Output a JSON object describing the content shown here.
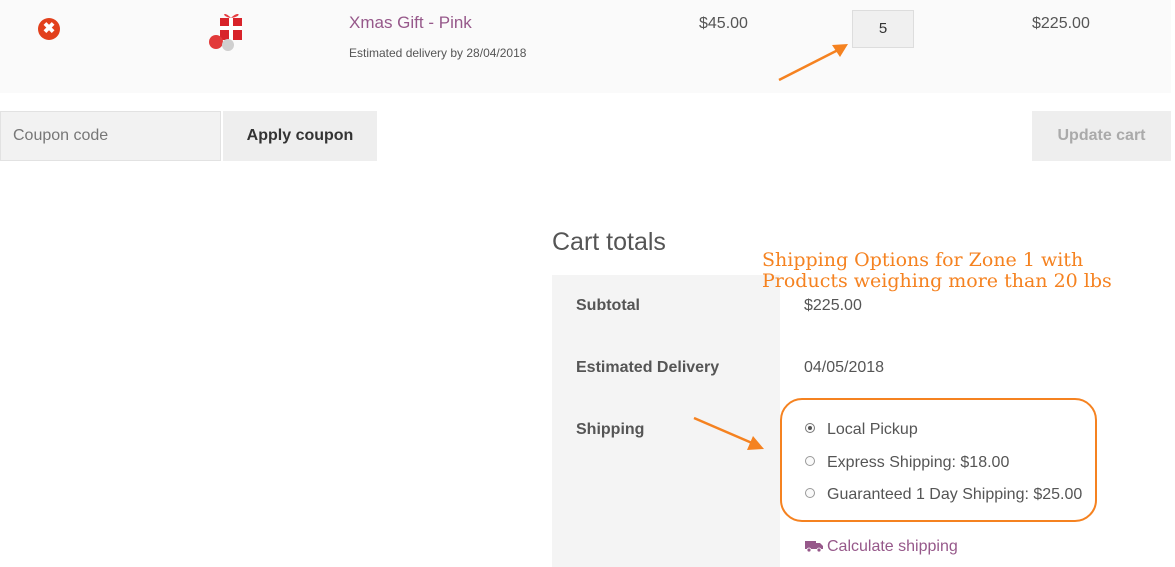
{
  "cart_item": {
    "product_name": "Xmas Gift - Pink",
    "delivery_note": "Estimated delivery by 28/04/2018",
    "price": "$45.00",
    "quantity": "5",
    "line_total": "$225.00",
    "remove_symbol": "✖"
  },
  "coupon": {
    "placeholder": "Coupon code",
    "apply_label": "Apply coupon"
  },
  "update_cart_label": "Update cart",
  "totals": {
    "title": "Cart totals",
    "subtotal_label": "Subtotal",
    "subtotal_value": "$225.00",
    "estimated_delivery_label": "Estimated Delivery",
    "estimated_delivery_value": "04/05/2018",
    "shipping_label": "Shipping",
    "shipping_options": [
      {
        "label": "Local Pickup",
        "selected": true
      },
      {
        "label": "Express Shipping: $18.00",
        "selected": false
      },
      {
        "label": "Guaranteed 1 Day Shipping: $25.00",
        "selected": false
      }
    ],
    "calculate_shipping_label": "Calculate shipping"
  },
  "annotation": {
    "line1": "Shipping Options for Zone 1 with",
    "line2": "Products weighing more than 20 lbs"
  },
  "colors": {
    "accent": "#96588a",
    "annotation": "#f58220",
    "remove": "#e2401c"
  },
  "icons": [
    "remove-icon",
    "gift-thumbnail",
    "truck-icon",
    "arrow-annotation"
  ]
}
